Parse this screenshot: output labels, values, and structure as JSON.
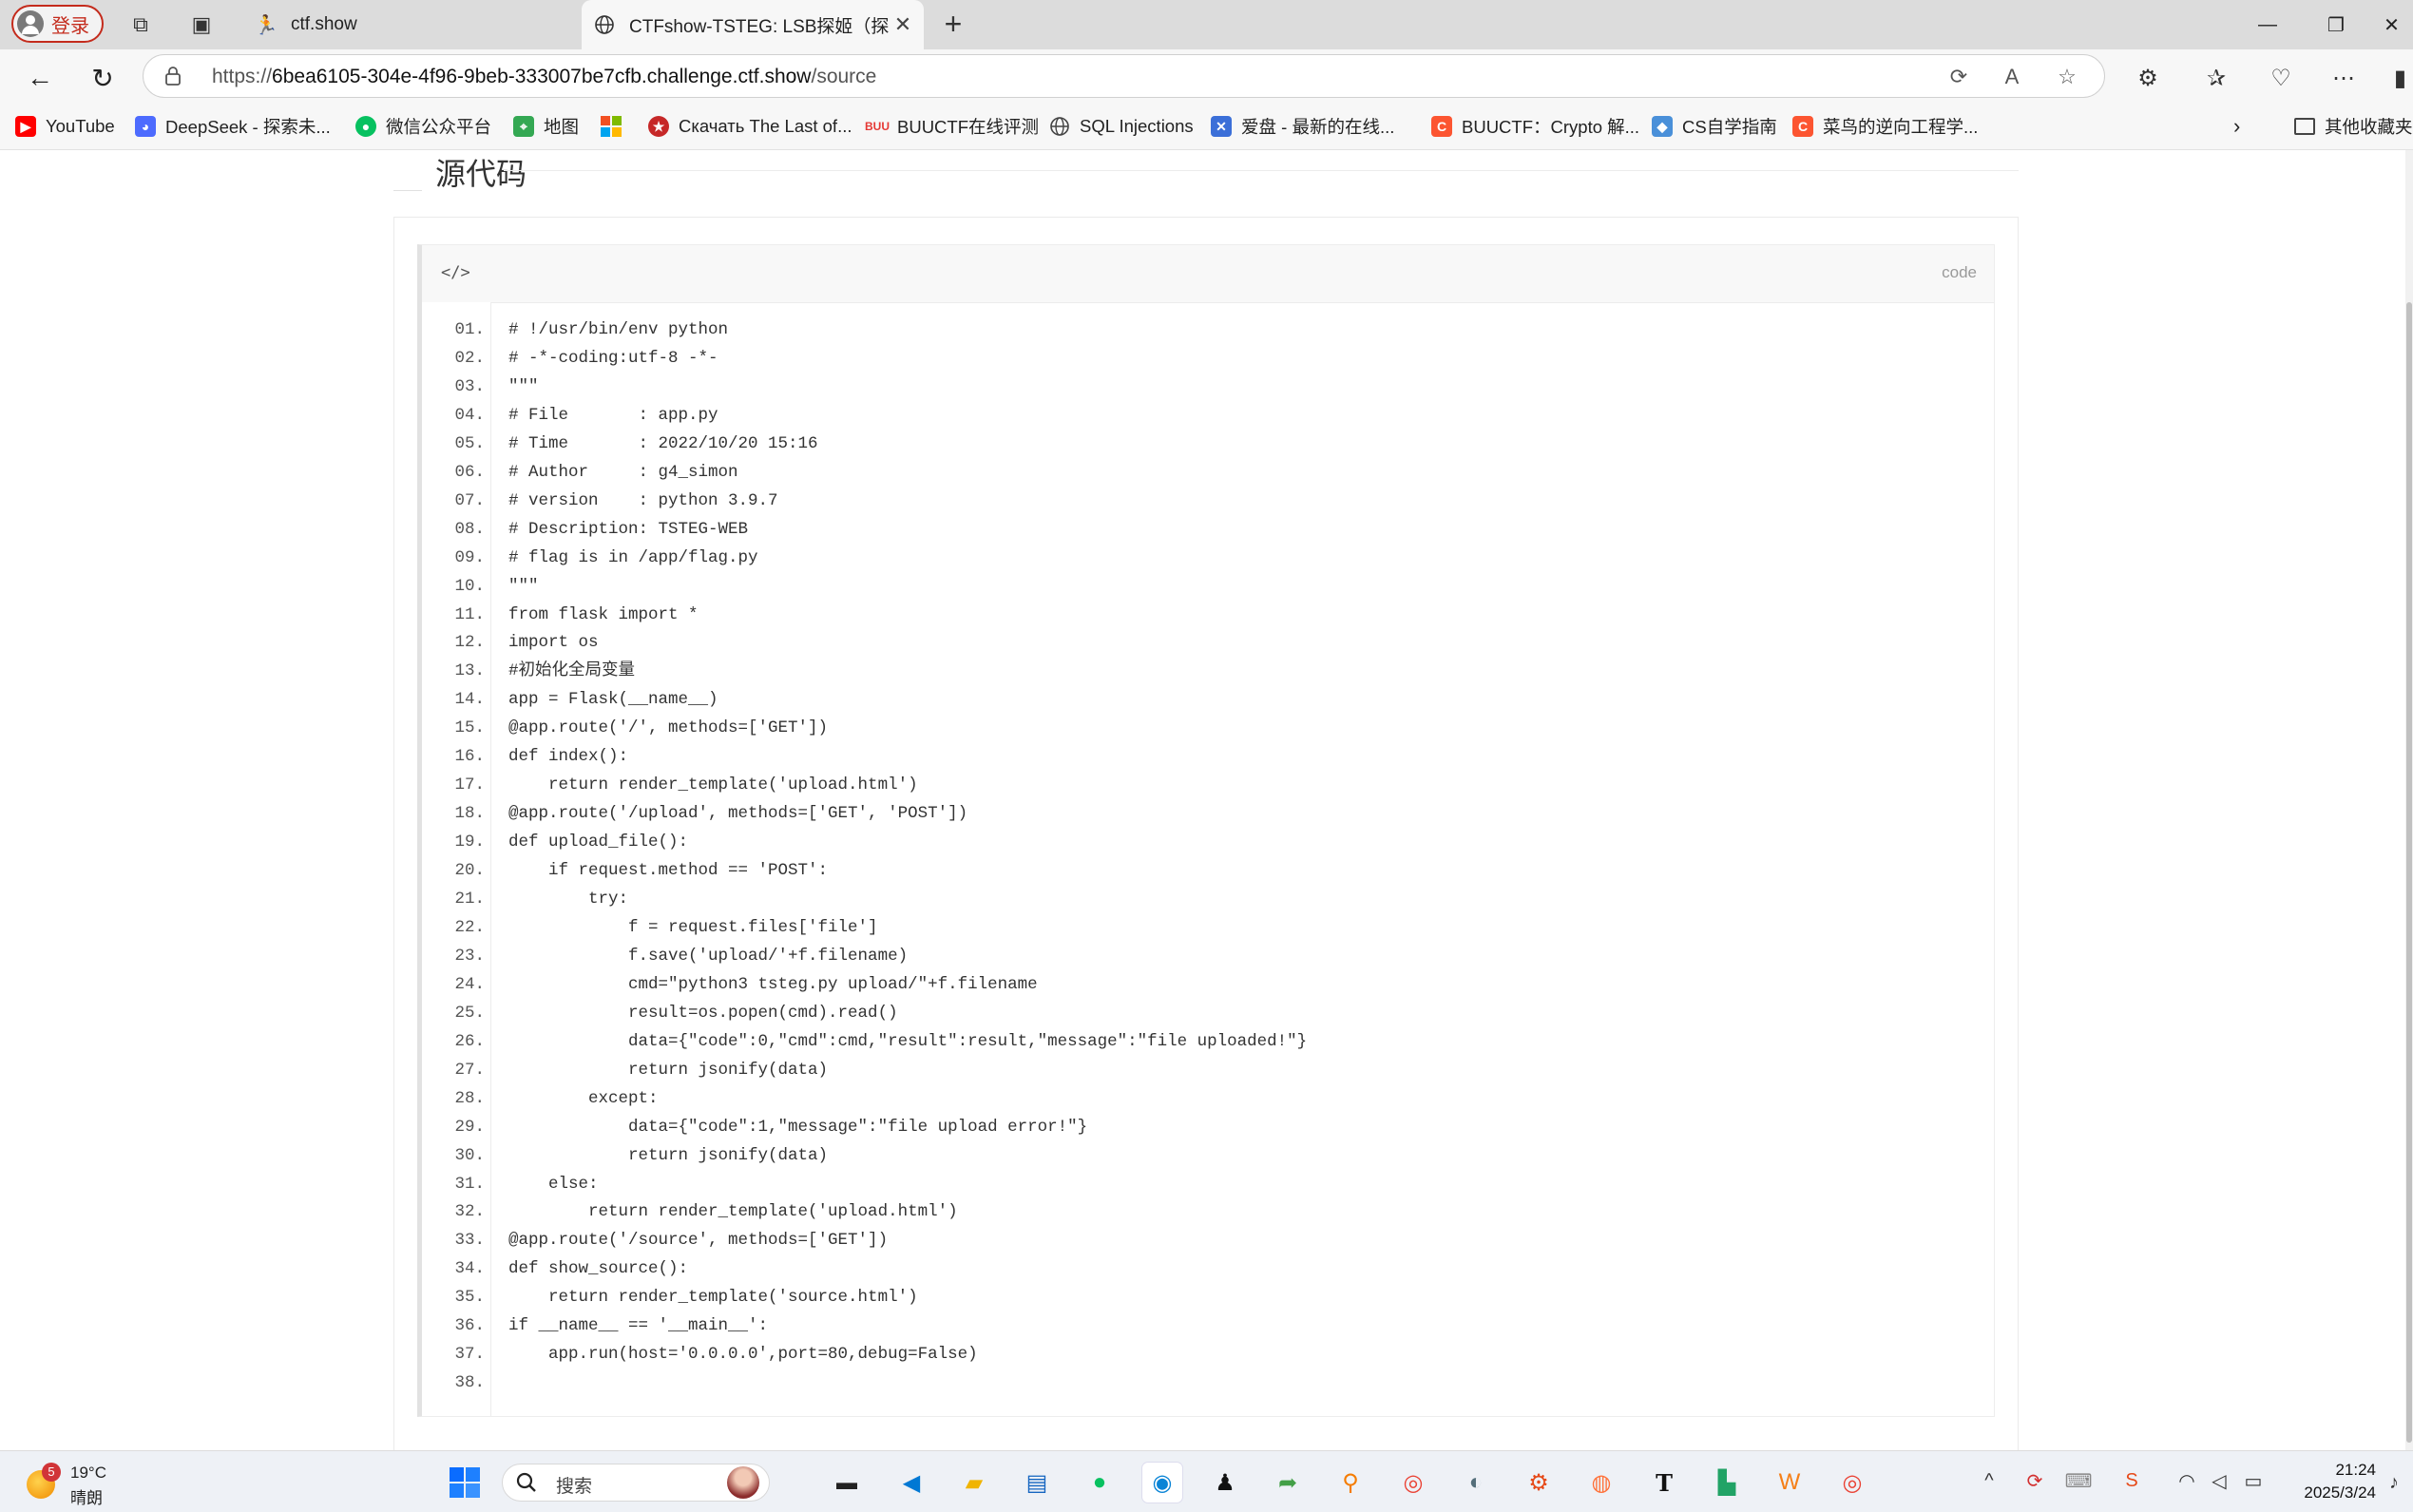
{
  "browser": {
    "profile_label": "登录",
    "tabs": [
      {
        "title": "ctf.show",
        "active": false
      },
      {
        "title": "CTFshow-TSTEG: LSB探姬（探姬",
        "active": true
      }
    ],
    "address": {
      "prefix": "https://",
      "host": "6bea6105-304e-4f96-9beb-333007be7cfb.challenge.ctf.show",
      "path": "/source"
    },
    "bookmarks": [
      {
        "label": "YouTube",
        "icon": "youtube-icon",
        "color": "#ff0000"
      },
      {
        "label": "DeepSeek - 探索未...",
        "icon": "deepseek-icon",
        "color": "#4d6bfe"
      },
      {
        "label": "微信公众平台",
        "icon": "wechat-icon",
        "color": "#07c160"
      },
      {
        "label": "地图",
        "icon": "map-icon",
        "color": "#34a853"
      },
      {
        "label": "",
        "icon": "windows-icon",
        "color": "#f25022"
      },
      {
        "label": "Скачать The Last of...",
        "icon": "download-site-icon",
        "color": "#c62828"
      },
      {
        "label": "BUUCTF在线评测",
        "icon": "buuctf-icon",
        "color": "#e53935"
      },
      {
        "label": "SQL Injections",
        "icon": "globe-icon",
        "color": "#555555"
      },
      {
        "label": "爱盘 - 最新的在线...",
        "icon": "aipan-icon",
        "color": "#3b6fd8"
      },
      {
        "label": "BUUCTF：Crypto 解...",
        "icon": "csdn-icon",
        "color": "#fc5531"
      },
      {
        "label": "CS自学指南",
        "icon": "cube-icon",
        "color": "#4a90d9"
      },
      {
        "label": "菜鸟的逆向工程学...",
        "icon": "csdn-icon",
        "color": "#fc5531"
      }
    ],
    "other_bookmarks": "其他收藏夹"
  },
  "page": {
    "section_title": "源代码",
    "code_tag": "</>",
    "code_lang": "code",
    "code_lines": [
      {
        "n": "01.",
        "t": "# !/usr/bin/env python"
      },
      {
        "n": "02.",
        "t": "# -*-coding:utf-8 -*-"
      },
      {
        "n": "03.",
        "t": "\"\"\""
      },
      {
        "n": "04.",
        "t": "# File       : app.py"
      },
      {
        "n": "05.",
        "t": "# Time       : 2022/10/20 15:16"
      },
      {
        "n": "06.",
        "t": "# Author     : g4_simon"
      },
      {
        "n": "07.",
        "t": "# version    : python 3.9.7"
      },
      {
        "n": "08.",
        "t": "# Description: TSTEG-WEB"
      },
      {
        "n": "09.",
        "t": "# flag is in /app/flag.py"
      },
      {
        "n": "10.",
        "t": "\"\"\""
      },
      {
        "n": "11.",
        "t": "from flask import *"
      },
      {
        "n": "12.",
        "t": "import os"
      },
      {
        "n": "13.",
        "t": "#初始化全局变量"
      },
      {
        "n": "14.",
        "t": "app = Flask(__name__)"
      },
      {
        "n": "15.",
        "t": "@app.route('/', methods=['GET'])"
      },
      {
        "n": "16.",
        "t": "def index():"
      },
      {
        "n": "17.",
        "t": "    return render_template('upload.html')"
      },
      {
        "n": "18.",
        "t": "@app.route('/upload', methods=['GET', 'POST'])"
      },
      {
        "n": "19.",
        "t": "def upload_file():"
      },
      {
        "n": "20.",
        "t": "    if request.method == 'POST':"
      },
      {
        "n": "21.",
        "t": "        try:"
      },
      {
        "n": "22.",
        "t": "            f = request.files['file']"
      },
      {
        "n": "23.",
        "t": "            f.save('upload/'+f.filename)"
      },
      {
        "n": "24.",
        "t": "            cmd=\"python3 tsteg.py upload/\"+f.filename"
      },
      {
        "n": "25.",
        "t": "            result=os.popen(cmd).read()"
      },
      {
        "n": "26.",
        "t": "            data={\"code\":0,\"cmd\":cmd,\"result\":result,\"message\":\"file uploaded!\"}"
      },
      {
        "n": "27.",
        "t": "            return jsonify(data)"
      },
      {
        "n": "28.",
        "t": "        except:"
      },
      {
        "n": "29.",
        "t": "            data={\"code\":1,\"message\":\"file upload error!\"}"
      },
      {
        "n": "30.",
        "t": "            return jsonify(data)"
      },
      {
        "n": "31.",
        "t": "    else:"
      },
      {
        "n": "32.",
        "t": "        return render_template('upload.html')"
      },
      {
        "n": "33.",
        "t": "@app.route('/source', methods=['GET'])"
      },
      {
        "n": "34.",
        "t": "def show_source():"
      },
      {
        "n": "35.",
        "t": "    return render_template('source.html')"
      },
      {
        "n": "36.",
        "t": "if __name__ == '__main__':"
      },
      {
        "n": "37.",
        "t": "    app.run(host='0.0.0.0',port=80,debug=False)"
      },
      {
        "n": "38.",
        "t": ""
      }
    ]
  },
  "taskbar": {
    "weather_badge": "5",
    "weather_temp": "19°C",
    "weather_cond": "晴朗",
    "search_placeholder": "搜索",
    "time": "21:24",
    "date": "2025/3/24"
  }
}
